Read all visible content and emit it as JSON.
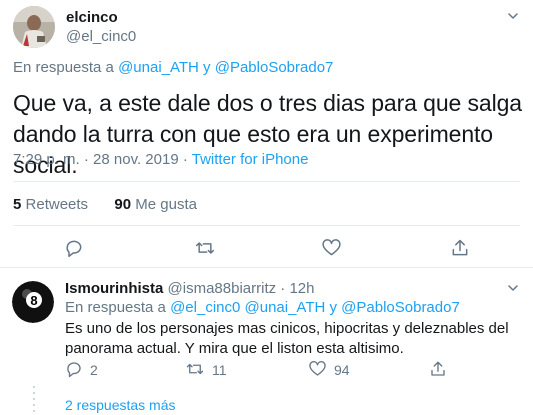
{
  "main_tweet": {
    "display_name": "elcinco",
    "handle": "@el_cinc0",
    "reply_prefix": "En respuesta a",
    "reply_to": "@unai_ATH y @PabloSobrado7",
    "text": "Que va, a este dale dos o tres dias para que salga dando la turra con que esto era un experimento social.",
    "time": "7:29 p. m. · 28 nov. 2019 ·",
    "source": "Twitter for iPhone",
    "retweets_count": "5",
    "retweets_label": "Retweets",
    "likes_count": "90",
    "likes_label": "Me gusta"
  },
  "reply_tweet": {
    "display_name": "Ismourinhista",
    "handle_time": "@isma88biarritz · 12h",
    "reply_prefix": "En respuesta a",
    "reply_to": "@el_cinc0 @unai_ATH y @PabloSobrado7",
    "text": "Es uno de los personajes mas cinicos, hipocritas y deleznables del panorama actual. Y mira que el liston esta altisimo.",
    "reply_count": "2",
    "retweet_count": "11",
    "like_count": "94"
  },
  "more_replies": "2 respuestas más",
  "colors": {
    "accent": "#1da1f2",
    "secondary_text": "#657786",
    "divider": "#e6ecf0"
  },
  "icons": [
    "chevron-down-icon",
    "reply-icon",
    "retweet-icon",
    "like-icon",
    "share-icon",
    "eight-ball-icon"
  ]
}
